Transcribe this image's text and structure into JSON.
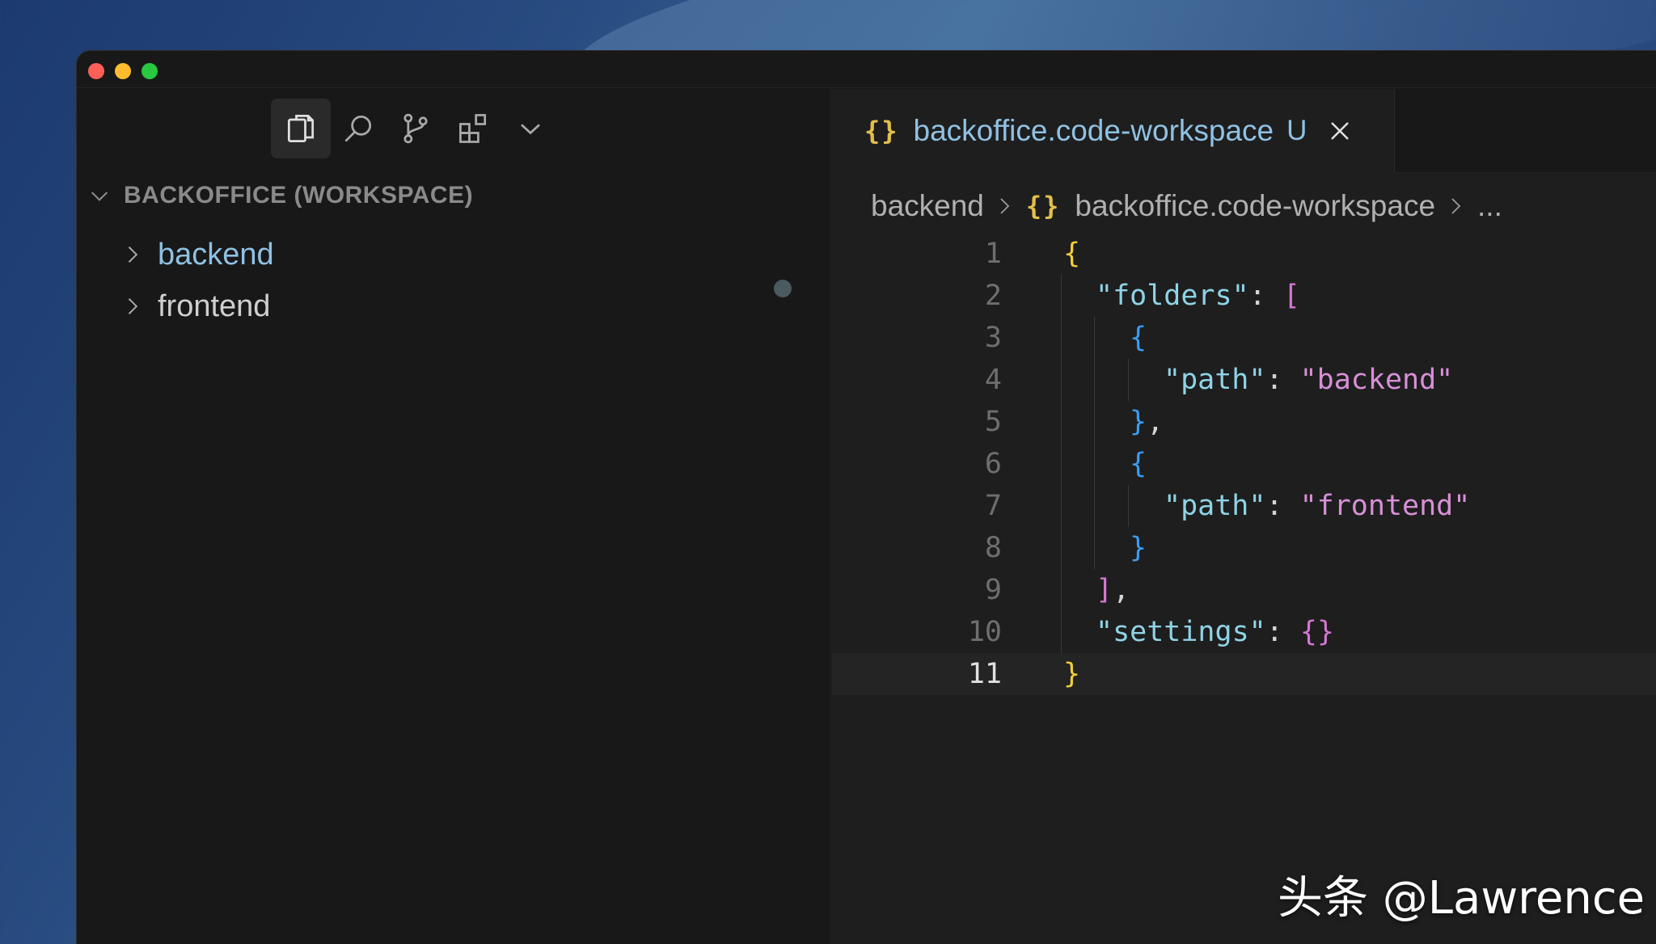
{
  "tab": {
    "icon_glyph": "{}",
    "label": "backoffice.code-workspace",
    "badge": "U"
  },
  "breadcrumb": {
    "folder": "backend",
    "icon_glyph": "{}",
    "file": "backoffice.code-workspace",
    "more": "..."
  },
  "explorer": {
    "workspace_title": "BACKOFFICE (WORKSPACE)",
    "folders": [
      {
        "name": "backend"
      },
      {
        "name": "frontend"
      }
    ]
  },
  "activity_bar": {
    "icons": [
      "explorer-icon",
      "search-icon",
      "source-control-icon",
      "extensions-icon",
      "chevron-down-icon"
    ]
  },
  "code": {
    "current_line": 11,
    "lines": [
      {
        "num": "1",
        "segments": [
          {
            "t": "{",
            "c": "b1"
          }
        ]
      },
      {
        "num": "2",
        "segments": [
          {
            "t": "\"folders\"",
            "c": "key"
          },
          {
            "t": ": ",
            "c": "punc"
          },
          {
            "t": "[",
            "c": "b2"
          }
        ]
      },
      {
        "num": "3",
        "segments": [
          {
            "t": "{",
            "c": "b3"
          }
        ]
      },
      {
        "num": "4",
        "segments": [
          {
            "t": "\"path\"",
            "c": "key"
          },
          {
            "t": ": ",
            "c": "punc"
          },
          {
            "t": "\"backend\"",
            "c": "str"
          }
        ]
      },
      {
        "num": "5",
        "segments": [
          {
            "t": "}",
            "c": "b3"
          },
          {
            "t": ",",
            "c": "punc"
          }
        ]
      },
      {
        "num": "6",
        "segments": [
          {
            "t": "{",
            "c": "b3"
          }
        ]
      },
      {
        "num": "7",
        "segments": [
          {
            "t": "\"path\"",
            "c": "key"
          },
          {
            "t": ": ",
            "c": "punc"
          },
          {
            "t": "\"frontend\"",
            "c": "str"
          }
        ]
      },
      {
        "num": "8",
        "segments": [
          {
            "t": "}",
            "c": "b3"
          }
        ]
      },
      {
        "num": "9",
        "segments": [
          {
            "t": "]",
            "c": "b2"
          },
          {
            "t": ",",
            "c": "punc"
          }
        ]
      },
      {
        "num": "10",
        "segments": [
          {
            "t": "\"settings\"",
            "c": "key"
          },
          {
            "t": ": ",
            "c": "punc"
          },
          {
            "t": "{}",
            "c": "b2"
          }
        ]
      },
      {
        "num": "11",
        "segments": [
          {
            "t": "}",
            "c": "b1"
          }
        ]
      }
    ]
  },
  "watermark": "头条 @Lawrence",
  "colors": {
    "accent_blue": "#8fc1e3",
    "json_key": "#8fd3e6",
    "json_string": "#d790d6",
    "bracket_level1": "#f2cf3a",
    "bracket_level2": "#d377d0",
    "bracket_level3": "#3a9cf0"
  }
}
